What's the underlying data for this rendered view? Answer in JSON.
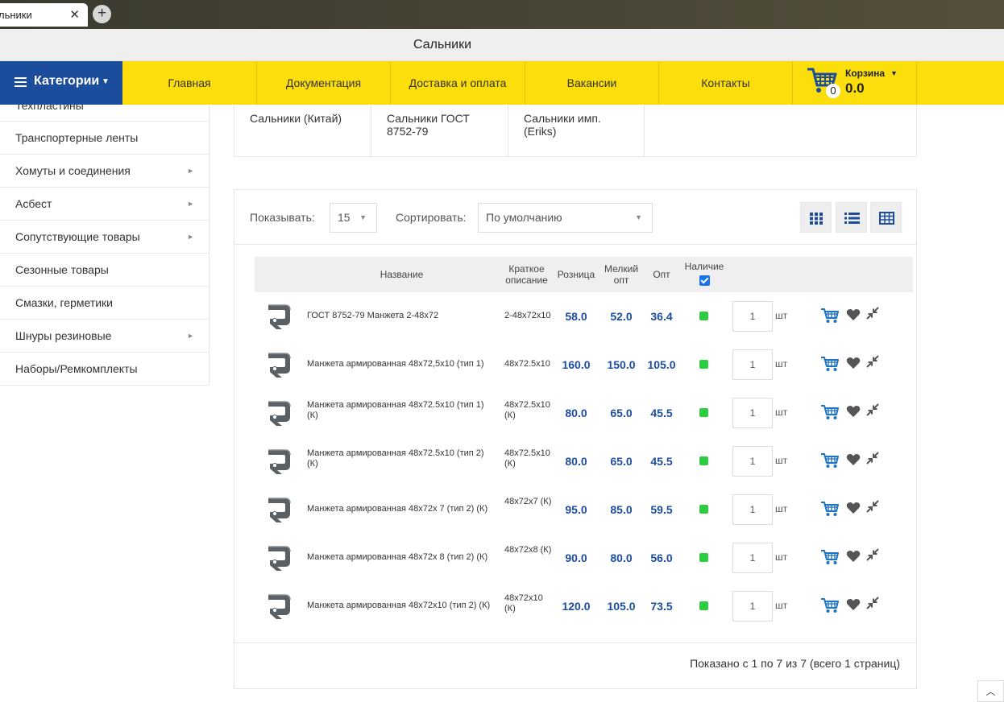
{
  "browser": {
    "tab_title": "льники",
    "new_tab": "+"
  },
  "page": {
    "title": "Сальники"
  },
  "nav": {
    "categories_label": "Категории",
    "items": [
      "Главная",
      "Документация",
      "Доставка и оплата",
      "Вакансии",
      "Контакты"
    ],
    "cart": {
      "label": "Корзина",
      "count": "0",
      "total": "0.0"
    }
  },
  "sidebar": {
    "items": [
      {
        "label": "Техпластины",
        "arrow": "►"
      },
      {
        "label": "Транспортерные ленты",
        "arrow": ""
      },
      {
        "label": "Хомуты и соединения",
        "arrow": "►"
      },
      {
        "label": "Асбест",
        "arrow": "►"
      },
      {
        "label": "Сопутствующие товары",
        "arrow": "►"
      },
      {
        "label": "Сезонные товары",
        "arrow": ""
      },
      {
        "label": "Смазки, герметики",
        "arrow": ""
      },
      {
        "label": "Шнуры резиновые",
        "arrow": "►"
      },
      {
        "label": "Наборы/Ремкомплекты",
        "arrow": ""
      }
    ]
  },
  "subcategories": [
    "Сальники (Китай)",
    "Сальники ГОСТ 8752-79",
    "Сальники имп. (Eriks)"
  ],
  "toolbar": {
    "show_label": "Показывать:",
    "show_value": "15",
    "sort_label": "Сортировать:",
    "sort_value": "По умолчанию",
    "views": [
      "grid-view",
      "list-view",
      "table-view"
    ]
  },
  "table": {
    "headers": {
      "name": "Название",
      "desc": "Краткое описание",
      "retail": "Розница",
      "small_wholesale": "Мелкий опт",
      "wholesale": "Опт",
      "stock": "Наличие"
    },
    "rows": [
      {
        "name": "ГОСТ 8752-79 Манжета 2-48х72",
        "desc": "2-48х72х10",
        "retail": "58.0",
        "small": "52.0",
        "opt": "36.4",
        "qty": "1",
        "unit": "шт"
      },
      {
        "name": "Манжета армированная 48х72,5х10 (тип 1)",
        "desc": "48х72.5х10",
        "retail": "160.0",
        "small": "150.0",
        "opt": "105.0",
        "qty": "1",
        "unit": "шт"
      },
      {
        "name": "Манжета армированная 48х72.5х10 (тип 1) (К)",
        "desc": "48х72.5х10 (К)",
        "retail": "80.0",
        "small": "65.0",
        "opt": "45.5",
        "qty": "1",
        "unit": "шт"
      },
      {
        "name": "Манжета армированная 48х72.5х10 (тип 2) (К)",
        "desc": "48х72.5х10 (К)",
        "retail": "80.0",
        "small": "65.0",
        "opt": "45.5",
        "qty": "1",
        "unit": "шт"
      },
      {
        "name": "Манжета армированная 48х72х 7 (тип 2) (К)",
        "desc": "48х72х7 (К)",
        "retail": "95.0",
        "small": "85.0",
        "opt": "59.5",
        "qty": "1",
        "unit": "шт"
      },
      {
        "name": "Манжета армированная 48х72х 8 (тип 2) (К)",
        "desc": "48х72х8 (К)",
        "retail": "90.0",
        "small": "80.0",
        "opt": "56.0",
        "qty": "1",
        "unit": "шт"
      },
      {
        "name": "Манжета армированная 48х72х10 (тип 2) (К)",
        "desc": "48х72х10 (К)",
        "retail": "120.0",
        "small": "105.0",
        "opt": "73.5",
        "qty": "1",
        "unit": "шт"
      }
    ]
  },
  "pagination": {
    "summary": "Показано с 1 по 7 из 7 (всего 1 страниц)"
  },
  "colors": {
    "brand_blue": "#1c4d9c",
    "nav_yellow": "#fbde0c",
    "stock_green": "#2ecc40"
  }
}
